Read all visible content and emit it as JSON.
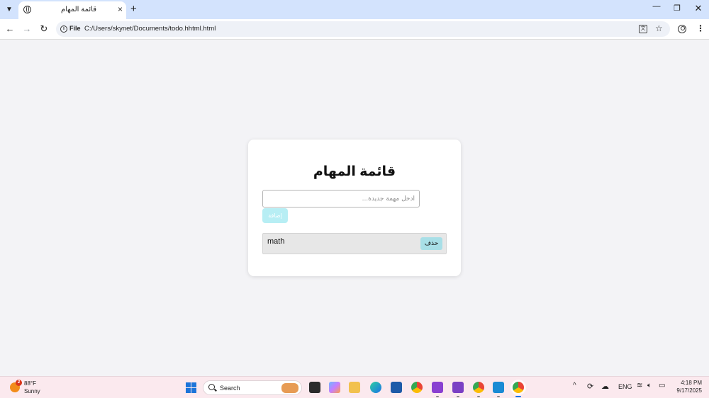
{
  "browser": {
    "tab": {
      "title": "قائمة المهام",
      "close_glyph": "×"
    },
    "new_tab_glyph": "+",
    "window_controls": {
      "minimize_glyph": "—",
      "maximize_glyph": "❐",
      "close_glyph": "✕"
    },
    "address_bar": {
      "scheme_label": "File",
      "url": "C:/Users/skynet/Documents/todo.hhtml.html"
    }
  },
  "page": {
    "title": "قائمة المهام",
    "input": {
      "placeholder": "أدخل مهمة جديدة...",
      "value": ""
    },
    "add_button_label": "إضافة",
    "tasks": [
      {
        "text": "math",
        "delete_label": "حذف"
      }
    ]
  },
  "taskbar": {
    "weather": {
      "badge_count": "2",
      "temperature": "88°F",
      "condition": "Sunny"
    },
    "search_label": "Search",
    "tray": {
      "language": "ENG"
    },
    "clock": {
      "time": "4:18 PM",
      "date": "9/17/2025"
    }
  },
  "colors": {
    "tab_strip": "#d3e3fd",
    "page_background": "#f3f3f6",
    "add_button": "#b7eef4",
    "delete_button": "#a8dfe7",
    "task_item": "#e7e7e7",
    "taskbar": "#fbe9ee"
  }
}
